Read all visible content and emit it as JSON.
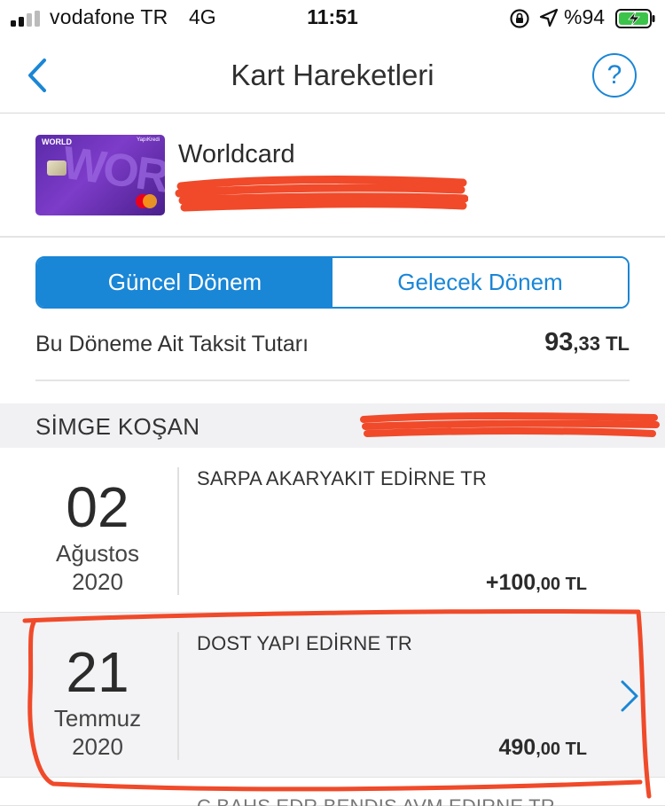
{
  "status_bar": {
    "carrier": "vodafone TR",
    "network": "4G",
    "time": "11:51",
    "battery_percent": "%94",
    "icons": [
      "signal-icon",
      "orientation-lock-icon",
      "location-icon",
      "battery-charging-icon"
    ]
  },
  "nav": {
    "title": "Kart Hareketleri",
    "help_label": "?",
    "icons": [
      "back-chevron-icon",
      "help-icon"
    ]
  },
  "card": {
    "name": "Worldcard",
    "image_brand": "WORLD",
    "image_bank": "YapıKredi",
    "image_word": "WORLD"
  },
  "segment": {
    "tabs": [
      {
        "label": "Güncel Dönem",
        "active": true
      },
      {
        "label": "Gelecek Dönem",
        "active": false
      }
    ]
  },
  "installment": {
    "label": "Bu Döneme Ait Taksit Tutarı",
    "amount_int": "93",
    "amount_dec": ",33 TL"
  },
  "section": {
    "cardholder": "SİMGE KOŞAN"
  },
  "transactions": [
    {
      "day": "02",
      "month": "Ağustos",
      "year": "2020",
      "merchant": "SARPA AKARYAKIT EDİRNE TR",
      "amount_int": "+100",
      "amount_dec": ",00 TL"
    },
    {
      "day": "21",
      "month": "Temmuz",
      "year": "2020",
      "merchant": "DOST YAPI EDİRNE TR",
      "amount_int": "490",
      "amount_dec": ",00 TL"
    },
    {
      "merchant": "C BAHS EDR BENDIS AVM EDIRNE TR"
    }
  ],
  "colors": {
    "accent": "#1a86d6",
    "annotation_red": "#f04a2a",
    "highlight_row": "#f3f3f5",
    "section_bg": "#f1f1f4"
  }
}
